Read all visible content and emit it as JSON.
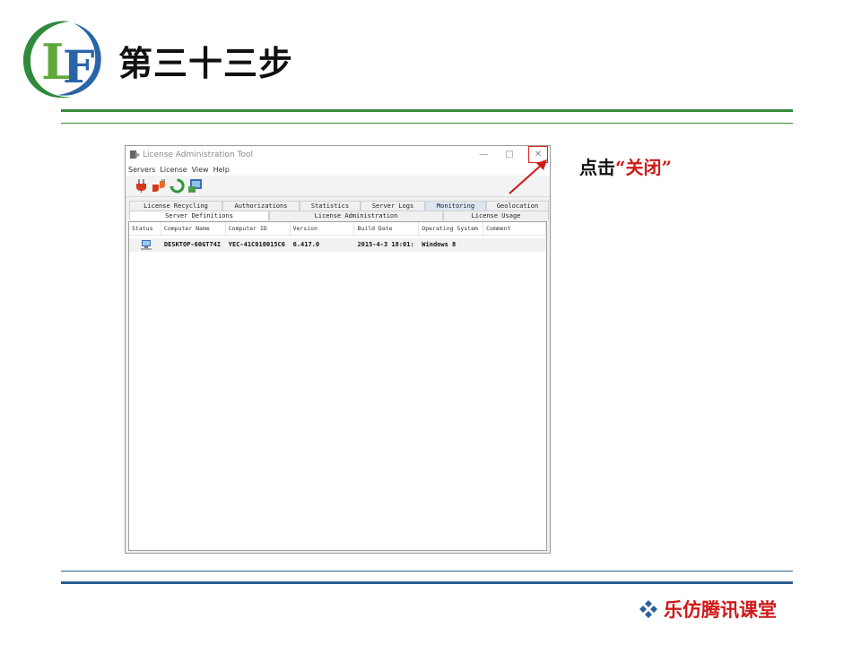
{
  "slide": {
    "logo_text": "LF",
    "title": "第三十三步",
    "annotation_prefix": "点击",
    "annotation_highlight": "“关闭”",
    "footer_brand": "乐仿腾讯课堂"
  },
  "window": {
    "title": "License Administration Tool",
    "controls": {
      "minimize": "—",
      "maximize": "□",
      "close": "✕"
    },
    "menu": [
      "Servers",
      "License",
      "View",
      "Help"
    ],
    "toolbar_icons": [
      "connect-plug-icon",
      "disconnect-plug-icon",
      "refresh-icon",
      "monitor-icon"
    ],
    "tabs_back": [
      "License Recycling",
      "Authorizations",
      "Statistics",
      "Server Logs",
      "Monitoring",
      "Geolocation"
    ],
    "tabs_front": [
      "Server Definitions",
      "License Administration",
      "License Usage"
    ],
    "columns": [
      "Status",
      "Computer Name",
      "Computer ID",
      "Version",
      "Build Date",
      "Operating System",
      "Comment"
    ],
    "rows": [
      {
        "status_icon": "computer-icon",
        "computer_name": "DESKTOP-60GT74I",
        "computer_id": "YEC-41C010015C6",
        "version": "6.417.0",
        "build_date": "2015-4-3 18:01:",
        "os": "Windows 8",
        "comment": ""
      }
    ]
  },
  "colors": {
    "accent_red": "#d01818",
    "rule_green": "#3a8a3a",
    "rule_blue": "#2d5f8f"
  }
}
